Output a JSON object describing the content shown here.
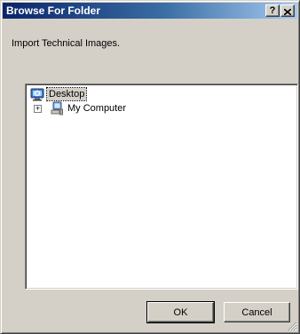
{
  "window": {
    "title": "Browse For Folder",
    "help_label": "?"
  },
  "instruction": "Import Technical Images.",
  "tree": {
    "items": [
      {
        "label": "Desktop",
        "icon": "desktop-icon",
        "selected": true
      },
      {
        "label": "My Computer",
        "icon": "my-computer-icon",
        "expander": "+"
      }
    ]
  },
  "buttons": {
    "ok_label": "OK",
    "cancel_label": "Cancel"
  },
  "colors": {
    "title_start": "#0a246a",
    "title_end": "#a6caf0",
    "face": "#d4d0c8"
  }
}
